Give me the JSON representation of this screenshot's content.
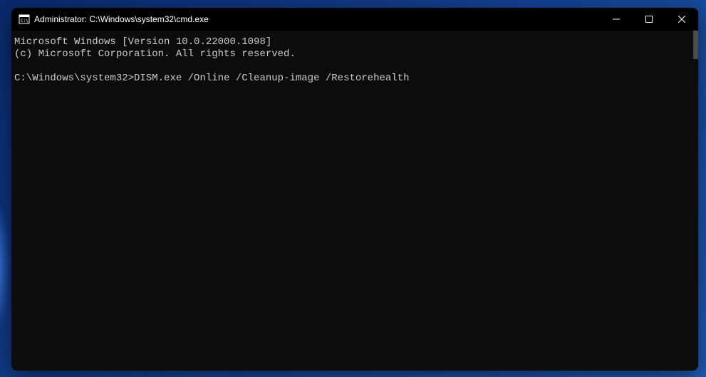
{
  "window": {
    "title": "Administrator: C:\\Windows\\system32\\cmd.exe"
  },
  "terminal": {
    "line1": "Microsoft Windows [Version 10.0.22000.1098]",
    "line2": "(c) Microsoft Corporation. All rights reserved.",
    "blank": "",
    "prompt": "C:\\Windows\\system32>",
    "command": "DISM.exe /Online /Cleanup-image /Restorehealth"
  }
}
